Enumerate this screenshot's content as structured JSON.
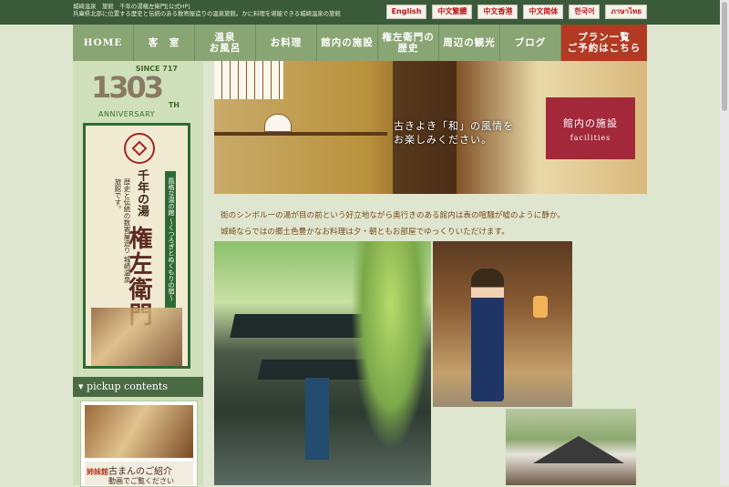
{
  "header": {
    "description_line1": "城崎温泉　旅館　千年の湯権左衛門[公式HP]",
    "description_line2": "兵庫県北部に位置する歴史と伝統のある数寄屋造りの温泉旅館。かに料理を堪能できる城崎温泉の旅館",
    "languages": [
      "English",
      "中文繁體",
      "中文香港",
      "中文简体",
      "한국어",
      "ภาษาไทย"
    ]
  },
  "nav": {
    "items": [
      {
        "label": "HOME"
      },
      {
        "label": "客　室"
      },
      {
        "label": "温泉\nお風呂"
      },
      {
        "label": "お料理"
      },
      {
        "label": "館内の施設"
      },
      {
        "label": "権左衛門の\n歴史"
      },
      {
        "label": "周辺の観光"
      },
      {
        "label": "ブログ"
      }
    ],
    "plan_label": "プラン一覧\nご予約はこちら"
  },
  "sidebar": {
    "anniversary": {
      "since": "SINCE 717",
      "number": "1303",
      "th": "TH",
      "text": "ANNIVERSARY"
    },
    "poster": {
      "tagline": "千年の湯",
      "desc": "歴史と伝統の数寄屋造り 城崎温泉旅館です。",
      "name": "権左衛門",
      "side_banner": "風格な湯の館 〜くつろぎとぬくもりの宿〜"
    },
    "pickup_title": "pickup contents",
    "pickup_card": {
      "badge": "姉妹館",
      "title": "古まんのご紹介",
      "subtitle": "動画でご覧ください"
    }
  },
  "hero": {
    "caption": "古きよき「和」の風情を\nお楽しみください。",
    "facilities_title": "館内の施設",
    "facilities_sub": "facilities"
  },
  "intro": {
    "line1": "街のシンボル一の湯が目の前という好立地ながら奥行きのある館内は表の喧騒が嘘のように静か。",
    "line2": "城崎ならではの郷土色豊かなお料理は夕・朝ともお部屋でゆっくりいただけます。"
  }
}
